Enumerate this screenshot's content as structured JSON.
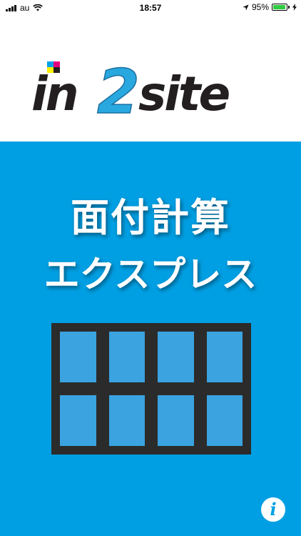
{
  "status_bar": {
    "carrier": "au",
    "time": "18:57",
    "battery_percent": "95%",
    "battery_level": 0.95
  },
  "header": {
    "logo_text": {
      "part1": "in",
      "part2": "2",
      "part3": "site"
    }
  },
  "main": {
    "title_line1": "面付計算",
    "title_line2": "エクスプレス",
    "info_label": "i"
  },
  "colors": {
    "main_background": "#009fe3",
    "grid_frame": "#2b2b2b",
    "grid_cell": "#3aa3e0",
    "logo_dark": "#231f20",
    "logo_accent": "#29a8e0"
  }
}
